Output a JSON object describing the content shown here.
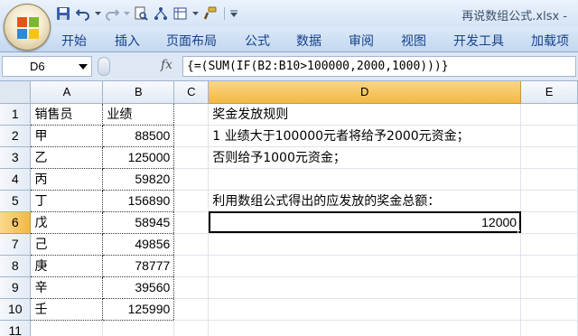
{
  "window": {
    "title": "再说数组公式.xlsx - "
  },
  "quick_access": {
    "items": [
      "save-icon",
      "undo-icon",
      "redo-icon",
      "print-preview-icon",
      "sort-icon",
      "table-icon",
      "format-painter-icon"
    ]
  },
  "ribbon": {
    "tabs": [
      "开始",
      "插入",
      "页面布局",
      "公式",
      "数据",
      "审阅",
      "视图",
      "开发工具",
      "加载项"
    ]
  },
  "formula_bar": {
    "name_box": "D6",
    "fx_label": "fx",
    "formula": "{=(SUM(IF(B2:B10>100000,2000,1000)))}"
  },
  "sheet": {
    "columns": [
      "A",
      "B",
      "C",
      "D",
      "E"
    ],
    "selected_column": "D",
    "selected_row": "6",
    "rows": [
      {
        "row": "1",
        "a": "销售员",
        "b": "业绩",
        "d": "奖金发放规则",
        "d_align": "left"
      },
      {
        "row": "2",
        "a": "甲",
        "b": "88500",
        "d": "1 业绩大于100000元者将给予2000元资金；",
        "d_align": "left"
      },
      {
        "row": "3",
        "a": "乙",
        "b": "125000",
        "d": "否则给予1000元资金；",
        "d_align": "left"
      },
      {
        "row": "4",
        "a": "丙",
        "b": "59820",
        "d": "",
        "d_align": "left"
      },
      {
        "row": "5",
        "a": "丁",
        "b": "156890",
        "d": "利用数组公式得出的应发放的奖金总额：",
        "d_align": "left"
      },
      {
        "row": "6",
        "a": "戊",
        "b": "58945",
        "d": "12000",
        "d_align": "right"
      },
      {
        "row": "7",
        "a": "己",
        "b": "49856",
        "d": "",
        "d_align": "left"
      },
      {
        "row": "8",
        "a": "庚",
        "b": "78777",
        "d": "",
        "d_align": "left"
      },
      {
        "row": "9",
        "a": "辛",
        "b": "39560",
        "d": "",
        "d_align": "left"
      },
      {
        "row": "10",
        "a": "壬",
        "b": "125990",
        "d": "",
        "d_align": "left"
      },
      {
        "row": "11",
        "a": "",
        "b": "",
        "d": "",
        "d_align": "left"
      }
    ]
  },
  "colors": {
    "ribbon_text": "#15428b",
    "selection_header": "#f3b944",
    "grid_line": "#dde3ea"
  }
}
